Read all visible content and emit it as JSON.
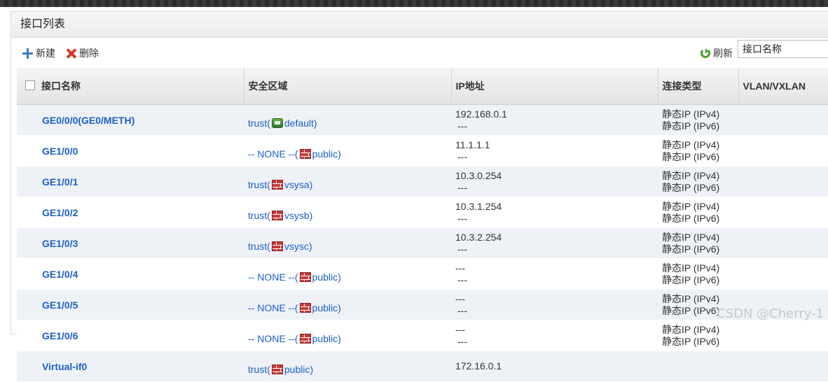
{
  "panel": {
    "title": "接口列表"
  },
  "toolbar": {
    "new_label": "新建",
    "delete_label": "删除",
    "refresh_label": "刷新",
    "search_value": "接口名称"
  },
  "table": {
    "headers": [
      "接口名称",
      "安全区域",
      "IP地址",
      "连接类型",
      "VLAN/VXLAN"
    ],
    "rows": [
      {
        "name": "GE0/0/0(GE0/METH)",
        "zone_prefix": "trust(",
        "zone_icon": "server-icon",
        "zone_name": "default)",
        "ip1": "192.168.0.1",
        "ip2": "---",
        "type1": "静态IP (IPv4)",
        "type2": "静态IP (IPv6)"
      },
      {
        "name": "GE1/0/0",
        "zone_prefix": "-- NONE --(",
        "zone_icon": "firewall-icon",
        "zone_name": "public)",
        "ip1": "11.1.1.1",
        "ip2": "---",
        "type1": "静态IP (IPv4)",
        "type2": "静态IP (IPv6)"
      },
      {
        "name": "GE1/0/1",
        "zone_prefix": "trust(",
        "zone_icon": "firewall-icon",
        "zone_name": "vsysa)",
        "ip1": "10.3.0.254",
        "ip2": "---",
        "type1": "静态IP (IPv4)",
        "type2": "静态IP (IPv6)"
      },
      {
        "name": "GE1/0/2",
        "zone_prefix": "trust(",
        "zone_icon": "firewall-icon",
        "zone_name": "vsysb)",
        "ip1": "10.3.1.254",
        "ip2": "---",
        "type1": "静态IP (IPv4)",
        "type2": "静态IP (IPv6)"
      },
      {
        "name": "GE1/0/3",
        "zone_prefix": "trust(",
        "zone_icon": "firewall-icon",
        "zone_name": "vsysc)",
        "ip1": "10.3.2.254",
        "ip2": "---",
        "type1": "静态IP (IPv4)",
        "type2": "静态IP (IPv6)"
      },
      {
        "name": "GE1/0/4",
        "zone_prefix": "-- NONE --(",
        "zone_icon": "firewall-icon",
        "zone_name": "public)",
        "ip1": "---",
        "ip2": "---",
        "type1": "静态IP (IPv4)",
        "type2": "静态IP (IPv6)"
      },
      {
        "name": "GE1/0/5",
        "zone_prefix": "-- NONE --(",
        "zone_icon": "firewall-icon",
        "zone_name": "public)",
        "ip1": "---",
        "ip2": "---",
        "type1": "静态IP (IPv4)",
        "type2": "静态IP (IPv6)"
      },
      {
        "name": "GE1/0/6",
        "zone_prefix": "-- NONE --(",
        "zone_icon": "firewall-icon",
        "zone_name": "public)",
        "ip1": "---",
        "ip2": "---",
        "type1": "静态IP (IPv4)",
        "type2": "静态IP (IPv6)"
      },
      {
        "name": "Virtual-if0",
        "zone_prefix": "trust(",
        "zone_icon": "firewall-icon",
        "zone_name": "public)",
        "ip1": "172.16.0.1",
        "ip2": "",
        "type1": "",
        "type2": ""
      }
    ]
  },
  "watermark": "CSDN @Cherry-1",
  "colors": {
    "link": "#1a5fc8",
    "row_alt": "#eef2f7",
    "firewall": "#c83a3a",
    "add": "#3b7cc4",
    "delete": "#d23a2a",
    "refresh": "#4aa02c"
  }
}
